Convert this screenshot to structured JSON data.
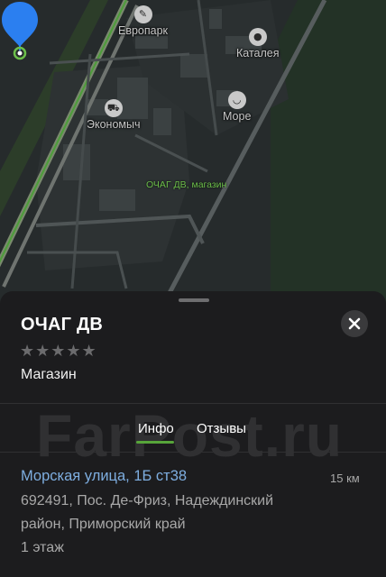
{
  "map": {
    "pois": [
      {
        "name": "Европарк",
        "icon": "shopping-bag-icon"
      },
      {
        "name": "Каталея",
        "icon": "person-pin-icon"
      },
      {
        "name": "Экономыч",
        "icon": "cart-icon"
      },
      {
        "name": "Море",
        "icon": "basket-icon"
      }
    ],
    "pin_label": "ОЧАГ ДВ, магазин",
    "pin_color": "#2b7ff0",
    "label_color": "#6cbf4a"
  },
  "place": {
    "title": "ОЧАГ ДВ",
    "rating_stars": "★★★★★",
    "category": "Магазин"
  },
  "tabs": {
    "info": "Инфо",
    "reviews": "Отзывы",
    "active": "info",
    "accent": "#57a53a"
  },
  "watermark": "FarPost.ru",
  "address": {
    "street": "Морская улица, 1Б ст38",
    "distance": "15 км",
    "line1": "692491, Пос. Де-Фриз, Надеждинский",
    "line2": "район, Приморский край",
    "line3": "1 этаж"
  }
}
